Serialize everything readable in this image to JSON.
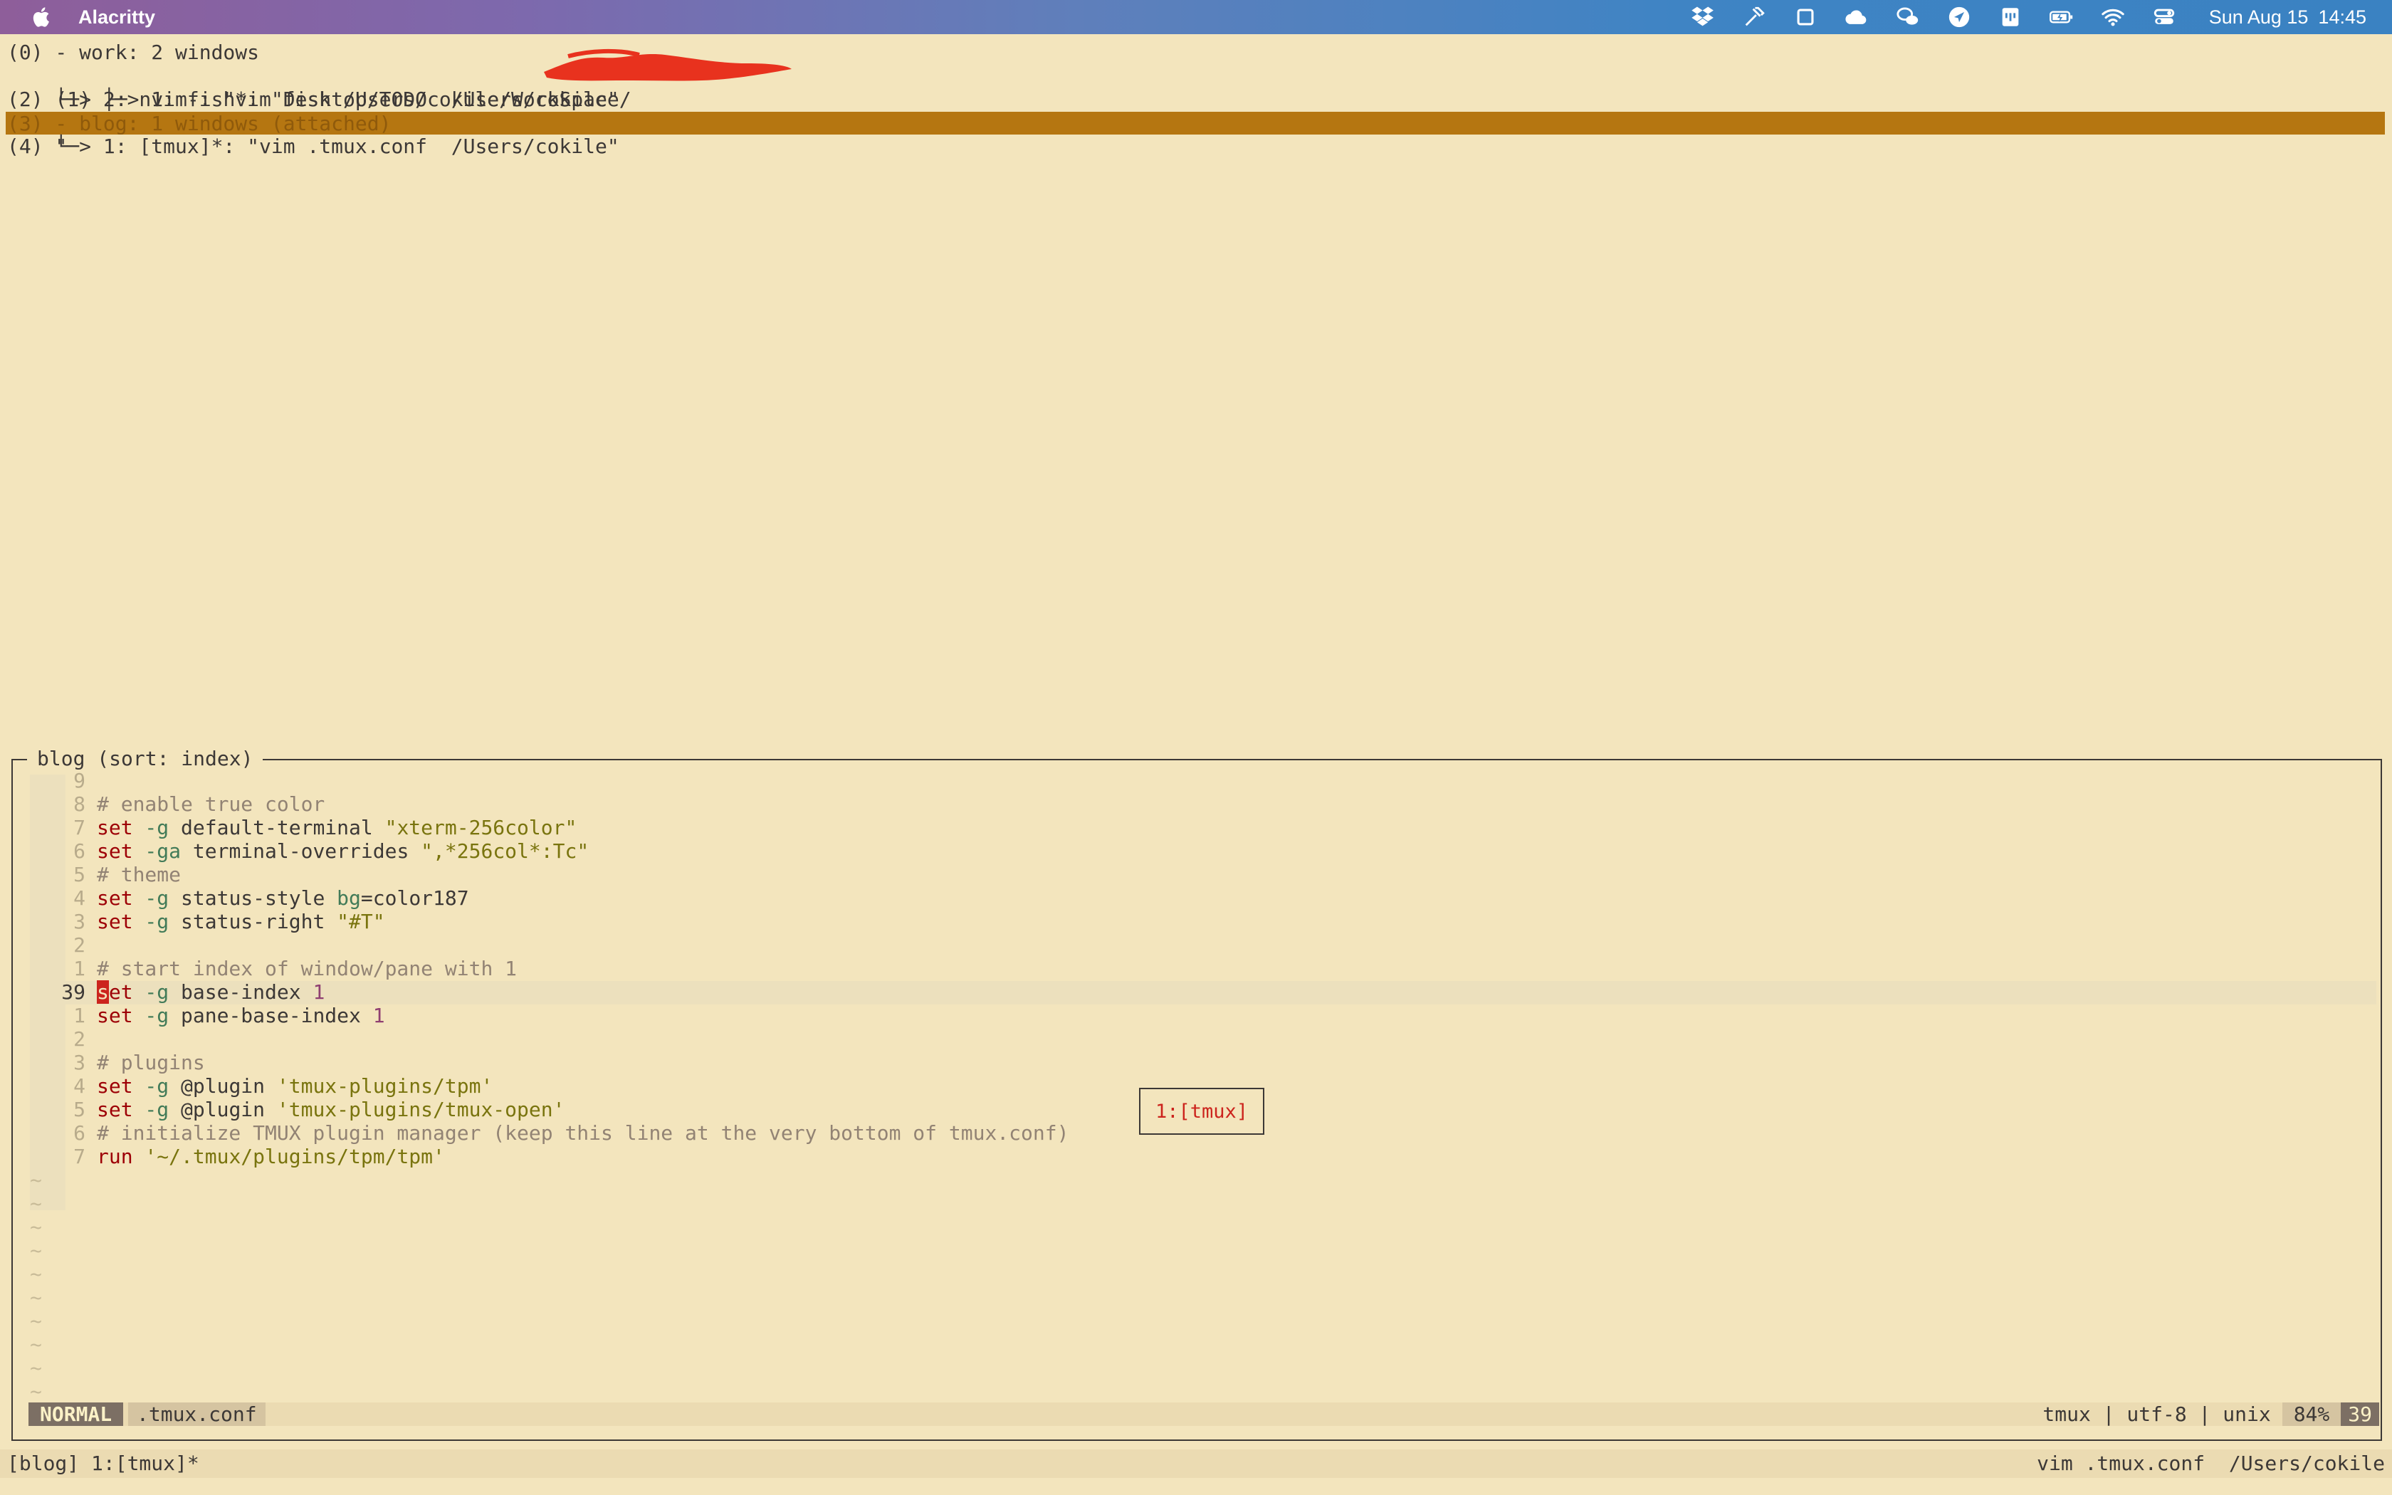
{
  "menubar": {
    "app_name": "Alacritty",
    "clock_day": "Sun Aug 15",
    "clock_time": "14:45",
    "tray_icons": [
      "dropbox-icon",
      "hammer-icon",
      "window-icon",
      "cloud-icon",
      "wechat-icon",
      "location-arrow-icon",
      "notes-icon",
      "battery-icon",
      "wifi-icon",
      "control-center-icon"
    ]
  },
  "tree": {
    "lines": [
      "(0) - work: 2 windows",
      "(1) ├─> 1: fish*: \"fish /Users/cokile/WorkSpace/",
      "(2) └─> 2: nvim-: \"vim Desktop/TODO  /Users/cokile\"",
      "(3) - blog: 1 windows (attached)",
      "(4) └─> 1: [tmux]*: \"vim .tmux.conf  /Users/cokile\""
    ],
    "line1_tail": "\"",
    "selected_index": 3
  },
  "preview": {
    "title": "blog (sort: index)",
    "line_numbers": [
      "9",
      "8",
      "7",
      "6",
      "5",
      "4",
      "3",
      "2",
      "1",
      "39",
      "1",
      "2",
      "3",
      "4",
      "5",
      "6",
      "7"
    ],
    "current_row": 9,
    "code": [
      [],
      [
        {
          "c": "cm",
          "t": "# enable true color"
        }
      ],
      [
        {
          "c": "kw",
          "t": "set"
        },
        {
          "c": "fl",
          "t": " -g"
        },
        {
          "c": "txt",
          "t": " default-terminal "
        },
        {
          "c": "st",
          "t": "\"xterm-256color\""
        }
      ],
      [
        {
          "c": "kw",
          "t": "set"
        },
        {
          "c": "fl",
          "t": " -ga"
        },
        {
          "c": "txt",
          "t": " terminal-overrides "
        },
        {
          "c": "st",
          "t": "\",*256col*:Tc\""
        }
      ],
      [
        {
          "c": "cm",
          "t": "# theme"
        }
      ],
      [
        {
          "c": "kw",
          "t": "set"
        },
        {
          "c": "fl",
          "t": " -g"
        },
        {
          "c": "txt",
          "t": " status-style "
        },
        {
          "c": "fl",
          "t": "bg"
        },
        {
          "c": "op",
          "t": "="
        },
        {
          "c": "txt",
          "t": "color187"
        }
      ],
      [
        {
          "c": "kw",
          "t": "set"
        },
        {
          "c": "fl",
          "t": " -g"
        },
        {
          "c": "txt",
          "t": " status-right "
        },
        {
          "c": "st",
          "t": "\"#T\""
        }
      ],
      [],
      [
        {
          "c": "cm",
          "t": "# start index of window/pane with 1"
        }
      ],
      [
        {
          "c": "cursor",
          "t": "s"
        },
        {
          "c": "kw",
          "t": "et"
        },
        {
          "c": "fl",
          "t": " -g"
        },
        {
          "c": "txt",
          "t": " base-index "
        },
        {
          "c": "nm",
          "t": "1"
        }
      ],
      [
        {
          "c": "kw",
          "t": "set"
        },
        {
          "c": "fl",
          "t": " -g"
        },
        {
          "c": "txt",
          "t": " pane-base-index "
        },
        {
          "c": "nm",
          "t": "1"
        }
      ],
      [],
      [
        {
          "c": "cm",
          "t": "# plugins"
        }
      ],
      [
        {
          "c": "kw",
          "t": "set"
        },
        {
          "c": "fl",
          "t": " -g"
        },
        {
          "c": "txt",
          "t": " @plugin "
        },
        {
          "c": "st",
          "t": "'tmux-plugins/tpm'"
        }
      ],
      [
        {
          "c": "kw",
          "t": "set"
        },
        {
          "c": "fl",
          "t": " -g"
        },
        {
          "c": "txt",
          "t": " @plugin "
        },
        {
          "c": "st",
          "t": "'tmux-plugins/tmux-open'"
        }
      ],
      [
        {
          "c": "cm",
          "t": "# initialize TMUX plugin manager (keep this line at the very bottom of tmux.conf)"
        }
      ],
      [
        {
          "c": "kw",
          "t": "run"
        },
        {
          "c": "st",
          "t": " '~/.tmux/plugins/tpm/tpm'"
        }
      ]
    ],
    "tilde_char": "~",
    "tilde_count": 10,
    "popup_label": "1:[tmux]",
    "statusline": {
      "mode": "NORMAL",
      "filename": ".tmux.conf",
      "filetype": "tmux",
      "encoding": "utf-8",
      "format": "unix",
      "percent": "84%",
      "line": "39"
    }
  },
  "tmux_status": {
    "left": "[blog] 1:[tmux]*",
    "right_cmd": "vim .tmux.conf",
    "right_path": "/Users/cokile"
  }
}
